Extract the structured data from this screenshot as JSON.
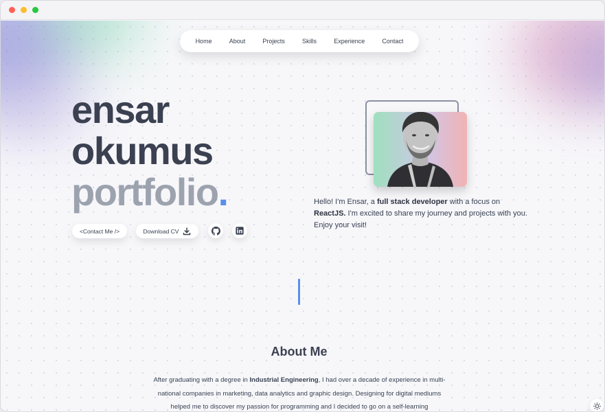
{
  "nav": {
    "items": [
      "Home",
      "About",
      "Projects",
      "Skills",
      "Experience",
      "Contact"
    ]
  },
  "hero": {
    "first_name": "ensar",
    "last_name": "okumus",
    "word": "portfolio",
    "period": ".",
    "accent_color": "#5b8fe6"
  },
  "buttons": {
    "contact_label": "<Contact Me />",
    "cv_label": "Download CV",
    "github_icon": "github-icon",
    "linkedin_icon": "linkedin-icon"
  },
  "bio": {
    "part1": "Hello! I'm Ensar, a ",
    "bold1": "full stack developer",
    "part2": " with a focus on ",
    "bold2": "ReactJS.",
    "part3": " I'm excited to share my journey and projects with you. Enjoy your visit!"
  },
  "about": {
    "title": "About Me",
    "text1": "After graduating with a degree in ",
    "bold1": "Industrial Engineering",
    "text2": ", I had over a decade of experience in multi-national companies in marketing, data analytics and graphic design. Designing for digital mediums helped me to discover my passion for programming and I decided to go on a self-learning"
  },
  "theme": {
    "icon": "sun-icon"
  }
}
